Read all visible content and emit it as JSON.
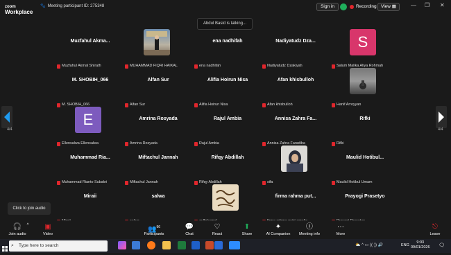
{
  "app": {
    "brand_top": "zoom",
    "brand_bottom": "Workplace"
  },
  "meeting": {
    "id_label": "Meeting participant ID: 275348"
  },
  "header": {
    "signin": "Sign in",
    "recording": "Recording",
    "view": "View"
  },
  "toast": {
    "talking": "Abdul Basid is talking..."
  },
  "pager": {
    "left": "4/4",
    "right": "4/4"
  },
  "tooltip": {
    "join_audio": "Click to join audio"
  },
  "tiles": [
    {
      "big": "Muzfahul  Akma...",
      "label": "Muzfahul Akmal Shirath"
    },
    {
      "big": "",
      "label": "MUHAMMAD FIQRI HAIKAL"
    },
    {
      "big": "ena nadhifah",
      "label": "ena nadhifah"
    },
    {
      "big": "Nadiyatudz  Dza...",
      "label": "Nadiyatudz Dzakiyah"
    },
    {
      "big": "",
      "label": "Salum Malika Aliya Rohmah",
      "letter": "S"
    },
    {
      "big": "M. SHOBIH_066",
      "label": "M. SHOBIH_066"
    },
    {
      "big": "Alfan Sur",
      "label": "Alfan Sur"
    },
    {
      "big": "Alifia Hoirun Nisa",
      "label": "Alifia Hoirun Nisa"
    },
    {
      "big": "Afan khisbulloh",
      "label": "Afan khisbulloh"
    },
    {
      "big": "",
      "label": "Hanif Arroyyan"
    },
    {
      "big": "",
      "label": "Ellensalwa Ellensalwa",
      "letter": "E"
    },
    {
      "big": "Amrina Rosyada",
      "label": "Amrina Rosyada"
    },
    {
      "big": "Rajul Ambia",
      "label": "Rajul Ambia"
    },
    {
      "big": "Annisa Zahra Fa...",
      "label": "Annisa Zahra Faradiba"
    },
    {
      "big": "Rifki",
      "label": "Rifki"
    },
    {
      "big": "Muhammad  Ria...",
      "label": "Muhammad Rianto Subakri"
    },
    {
      "big": "Miftachul Jannah",
      "label": "Miftachul Jannah"
    },
    {
      "big": "Rifqy Abdillah",
      "label": "Rifqy Abdillah"
    },
    {
      "big": "",
      "label": "sifa"
    },
    {
      "big": "Maulid  Hotibul...",
      "label": "Maulid Hotibul Umam"
    },
    {
      "big": "Miraii",
      "label": "Miraii"
    },
    {
      "big": "salwa",
      "label": "salwa"
    },
    {
      "big": "",
      "label": "zulfakamal"
    },
    {
      "big": "firma rahma put...",
      "label": "firma rahma putri amalia"
    },
    {
      "big": "Prayogi Prasetyo",
      "label": "Prayogi Prasetyo"
    }
  ],
  "toolbar": {
    "join_audio": "Join audio",
    "video": "Video",
    "participants": "Participants",
    "participants_count": "96",
    "chat": "Chat",
    "react": "React",
    "share": "Share",
    "ai_companion": "AI Companion",
    "meeting_info": "Meeting info",
    "more": "More",
    "leave": "Leave"
  },
  "taskbar": {
    "search_placeholder": "Type here to search",
    "lang": "ENG",
    "time": "9:03",
    "date": "09/01/2026"
  },
  "colors": {
    "accent_green": "#1fae5b",
    "record_red": "#e0262c",
    "avatar_s": "#d8366b",
    "avatar_e": "#7d5bbe"
  }
}
